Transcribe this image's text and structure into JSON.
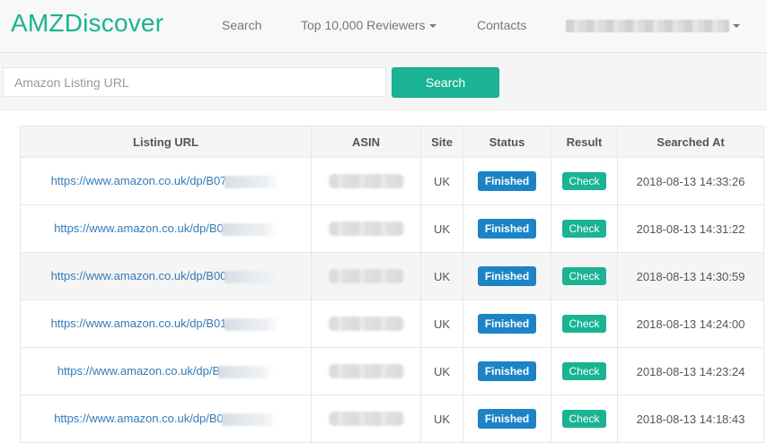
{
  "navbar": {
    "brand": "AMZDiscover",
    "search_link": "Search",
    "reviewers_link": "Top 10,000 Reviewers",
    "contacts_link": "Contacts"
  },
  "search": {
    "placeholder": "Amazon Listing URL",
    "value": "",
    "button_label": "Search"
  },
  "table": {
    "headers": {
      "listing_url": "Listing URL",
      "asin": "ASIN",
      "site": "Site",
      "status": "Status",
      "result": "Result",
      "searched_at": "Searched At"
    },
    "rows": [
      {
        "url": "https://www.amazon.co.uk/dp/B07",
        "site": "UK",
        "status": "Finished",
        "result": "Check",
        "searched_at": "2018-08-13 14:33:26"
      },
      {
        "url": "https://www.amazon.co.uk/dp/B0",
        "site": "UK",
        "status": "Finished",
        "result": "Check",
        "searched_at": "2018-08-13 14:31:22"
      },
      {
        "url": "https://www.amazon.co.uk/dp/B00",
        "site": "UK",
        "status": "Finished",
        "result": "Check",
        "searched_at": "2018-08-13 14:30:59"
      },
      {
        "url": "https://www.amazon.co.uk/dp/B01",
        "site": "UK",
        "status": "Finished",
        "result": "Check",
        "searched_at": "2018-08-13 14:24:00"
      },
      {
        "url": "https://www.amazon.co.uk/dp/B",
        "site": "UK",
        "status": "Finished",
        "result": "Check",
        "searched_at": "2018-08-13 14:23:24"
      },
      {
        "url": "https://www.amazon.co.uk/dp/B0",
        "site": "UK",
        "status": "Finished",
        "result": "Check",
        "searched_at": "2018-08-13 14:18:43"
      }
    ]
  },
  "colors": {
    "brand": "#1ab394",
    "status_badge": "#1c84c6",
    "link": "#337ab7"
  },
  "icons": {
    "dropdown": "caret-down-icon"
  }
}
